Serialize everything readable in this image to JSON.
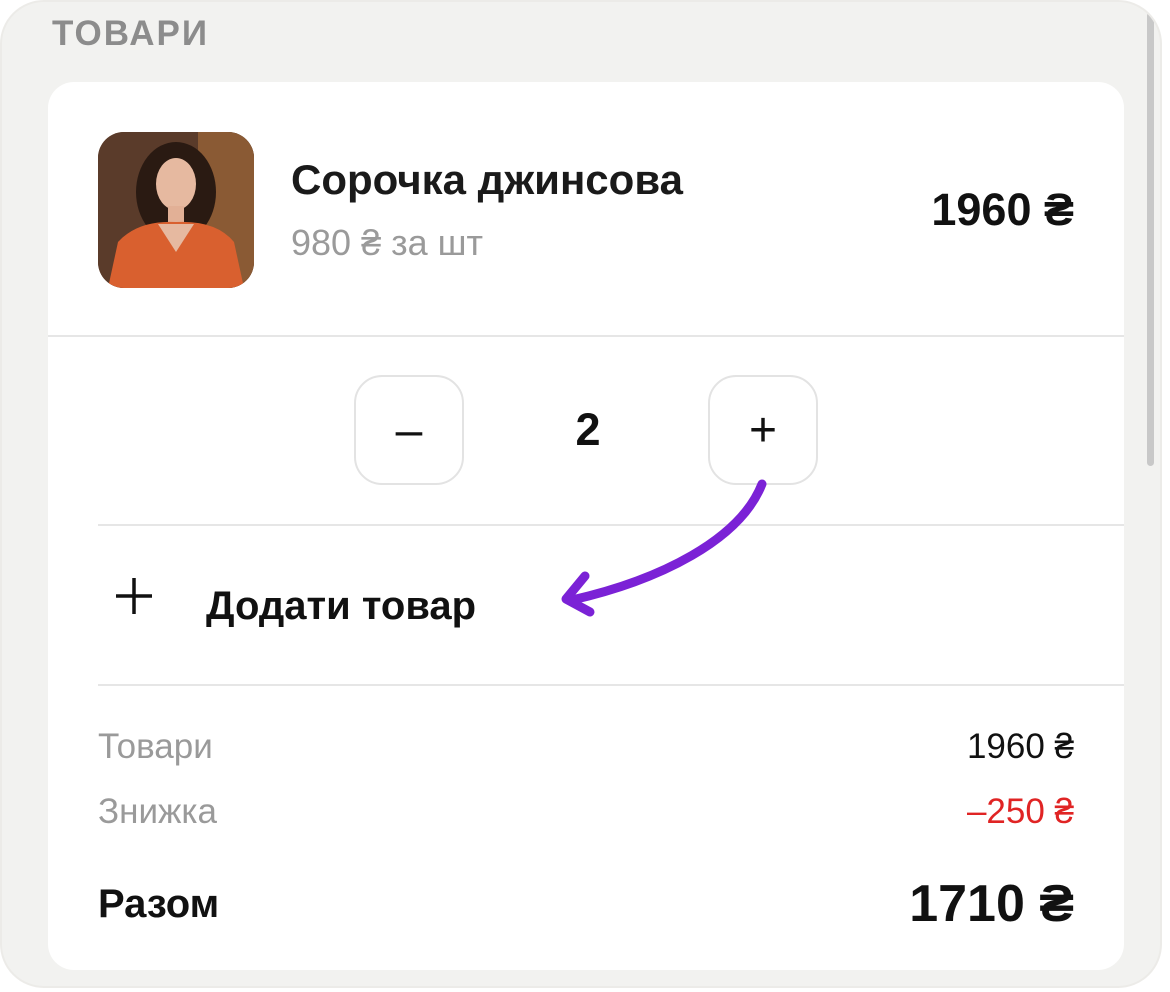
{
  "section": {
    "title": "ТОВАРИ"
  },
  "product": {
    "name": "Сорочка джинсова",
    "unit_price": "980 ₴ за шт",
    "line_total": "1960 ₴",
    "image_icon": "product-photo-icon"
  },
  "quantity": {
    "minus_label": "–",
    "value": "2",
    "plus_label": "+"
  },
  "add_item": {
    "icon": "plus-icon",
    "label": "Додати товар"
  },
  "summary": {
    "goods_label": "Товари",
    "goods_value": "1960 ₴",
    "discount_label": "Знижка",
    "discount_value": "–250 ₴",
    "total_label": "Разом",
    "total_value": "1710 ₴"
  },
  "colors": {
    "discount": "#e02424",
    "annotation_arrow": "#7b22d6",
    "background": "#f2f2f0"
  }
}
